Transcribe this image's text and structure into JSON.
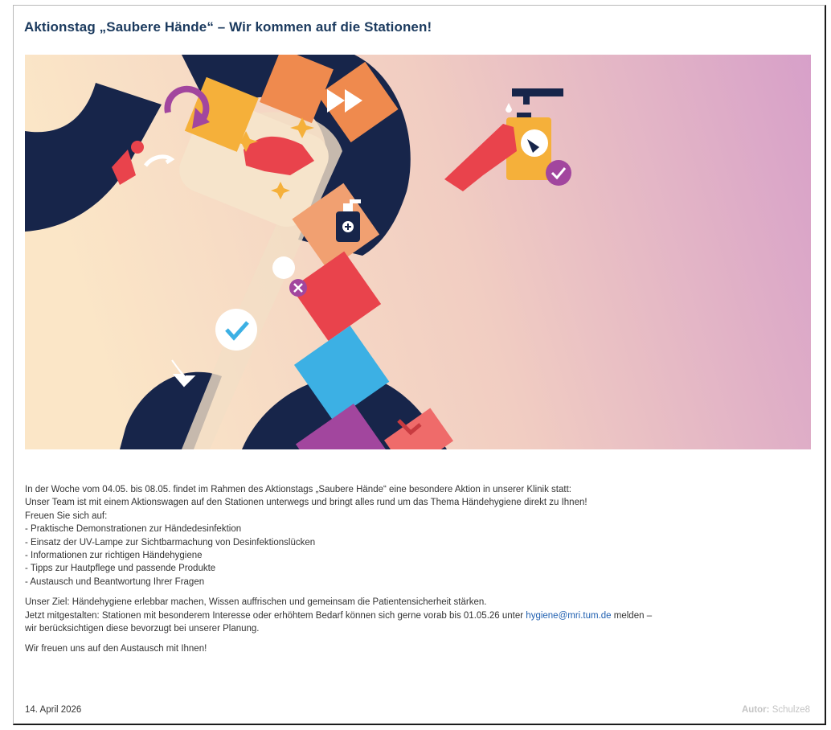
{
  "article": {
    "title": "Aktionstag „Saubere Hände“ – Wir kommen auf die Stationen!",
    "intro_line1": "In der Woche vom 04.05. bis 08.05. findet im Rahmen des Aktionstags „Saubere Hände“ eine besondere Aktion in unserer Klinik statt:",
    "intro_line2": "Unser Team ist mit einem Aktionswagen auf den Stationen unterwegs und bringt alles rund um das Thema Händehygiene direkt zu Ihnen!",
    "intro_line3": "Freuen Sie sich auf:",
    "bullets": [
      "- Praktische Demonstrationen zur Händedesinfektion",
      "- Einsatz der UV-Lampe zur Sichtbarmachung von Desinfektionslücken",
      "- Informationen zur richtigen Händehygiene",
      "- Tipps zur Hautpflege und passende Produkte",
      "- Austausch und Beantwortung Ihrer Fragen"
    ],
    "goal": "Unser Ziel: Händehygiene erlebbar machen, Wissen auffrischen und gemeinsam die Patientensicherheit stärken.",
    "cta_prefix": "Jetzt mitgestalten: Stationen mit besonderem Interesse oder erhöhtem Bedarf können sich gerne vorab bis 01.05.26 unter",
    "cta_email": "hygiene@mri.tum.de",
    "cta_suffix": "melden –",
    "cta_line2": "wir berücksichtigen diese bevorzugt bei unserer Planung.",
    "closing": "Wir freuen uns auf den Austausch mit Ihnen!",
    "date": "14. April 2026",
    "author_label": "Autor:",
    "author_name": "Schulze8"
  },
  "colors": {
    "title": "#1b3a5e",
    "link": "#1f5fb0",
    "navy": "#17254a",
    "orange": "#ef8a4e",
    "yellow": "#f5b03a",
    "red": "#e9434c",
    "blue": "#3cb0e4",
    "purple": "#a2469e"
  },
  "hero": {
    "icons": [
      "refresh-icon",
      "fast-forward-icon",
      "hand-icon",
      "virus-icon",
      "sanitizer-icon",
      "check-icon",
      "arrow-icon"
    ]
  }
}
